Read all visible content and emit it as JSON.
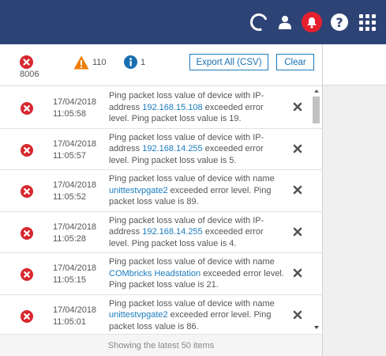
{
  "topbar": {
    "icons": [
      "loading-spinner-icon",
      "user-icon",
      "bell-alert-icon",
      "help-icon",
      "apps-grid-icon"
    ],
    "help_glyph": "?",
    "background": "#2e4375",
    "alert_color": "#e5202e"
  },
  "summary": {
    "error_count": "8006",
    "warning_count": "110",
    "info_count": "1",
    "export_label": "Export All (CSV)",
    "clear_label": "Clear"
  },
  "events": [
    {
      "date": "17/04/2018",
      "time": "11:05:58",
      "msg_pre": "Ping packet loss value of device with IP-address ",
      "msg_link": "192.168.15.108",
      "msg_post": " exceeded error level. Ping packet loss value is 19."
    },
    {
      "date": "17/04/2018",
      "time": "11:05:57",
      "msg_pre": "Ping packet loss value of device with IP-address ",
      "msg_link": "192.168.14.255",
      "msg_post": " exceeded error level. Ping packet loss value is 5."
    },
    {
      "date": "17/04/2018",
      "time": "11:05:52",
      "msg_pre": "Ping packet loss value of device with name ",
      "msg_link": "unittestvpgate2",
      "msg_post": " exceeded error level. Ping packet loss value is 89."
    },
    {
      "date": "17/04/2018",
      "time": "11:05:28",
      "msg_pre": "Ping packet loss value of device with IP-address ",
      "msg_link": "192.168.14.255",
      "msg_post": " exceeded error level. Ping packet loss value is 4."
    },
    {
      "date": "17/04/2018",
      "time": "11:05:15",
      "msg_pre": "Ping packet loss value of device with name ",
      "msg_link": "COMbricks Headstation",
      "msg_post": " exceeded error level. Ping packet loss value is 21."
    },
    {
      "date": "17/04/2018",
      "time": "11:05:01",
      "msg_pre": "Ping packet loss value of device with name ",
      "msg_link": "unittestvpgate2",
      "msg_post": " exceeded error level. Ping packet loss value is 86."
    }
  ],
  "footer": {
    "text": "Showing the latest 50 items"
  },
  "colors": {
    "error": "#d7282f",
    "warning": "#ef7d00",
    "info": "#1a6fb0",
    "link": "#1a7bbd"
  }
}
